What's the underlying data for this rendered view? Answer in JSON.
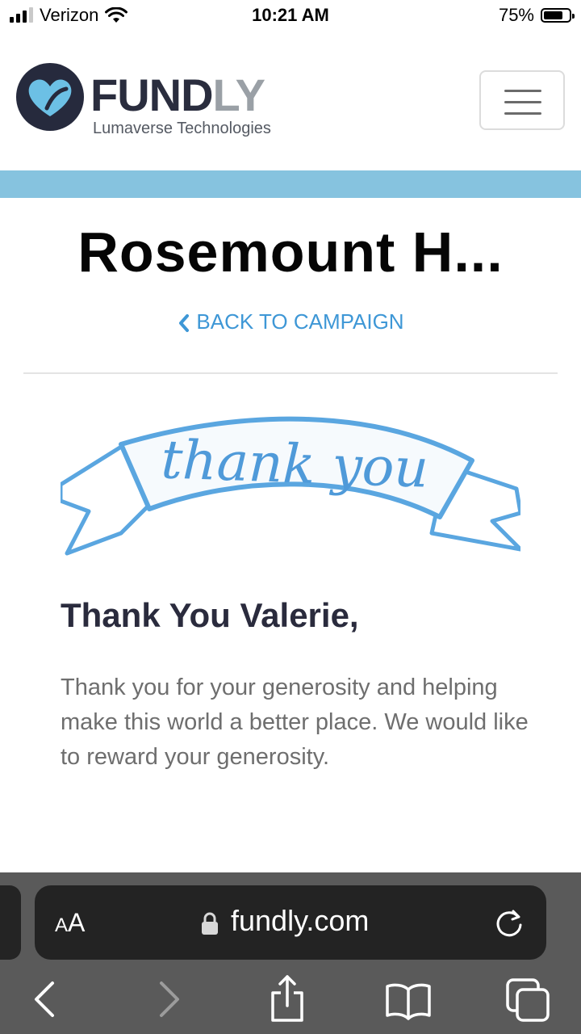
{
  "status_bar": {
    "carrier": "Verizon",
    "time": "10:21 AM",
    "battery": "75%",
    "battery_level": 0.75
  },
  "header": {
    "logo_word_main": "FUND",
    "logo_word_accent": "LY",
    "logo_subtitle": "Lumaverse Technologies",
    "logo_icon": "heart-icon",
    "menu_icon": "hamburger-icon",
    "band_color": "#86c3df"
  },
  "main": {
    "campaign_title": "Rosemount H...",
    "back_link": "BACK TO CAMPAIGN",
    "banner_text": "thank you",
    "thanks_heading": "Thank You Valerie,",
    "thanks_body": "Thank you for your generosity and helping make this world a better place. We would like to reward your generosity."
  },
  "browser": {
    "text_size_button": "AA",
    "url": "fundly.com",
    "toolbar_icons": [
      "back-icon",
      "forward-icon",
      "share-icon",
      "bookmarks-icon",
      "tabs-icon"
    ]
  },
  "colors": {
    "accent_blue": "#3e97d6",
    "brand_dark": "#2a2d3e",
    "chrome": "#5a5a5a"
  }
}
